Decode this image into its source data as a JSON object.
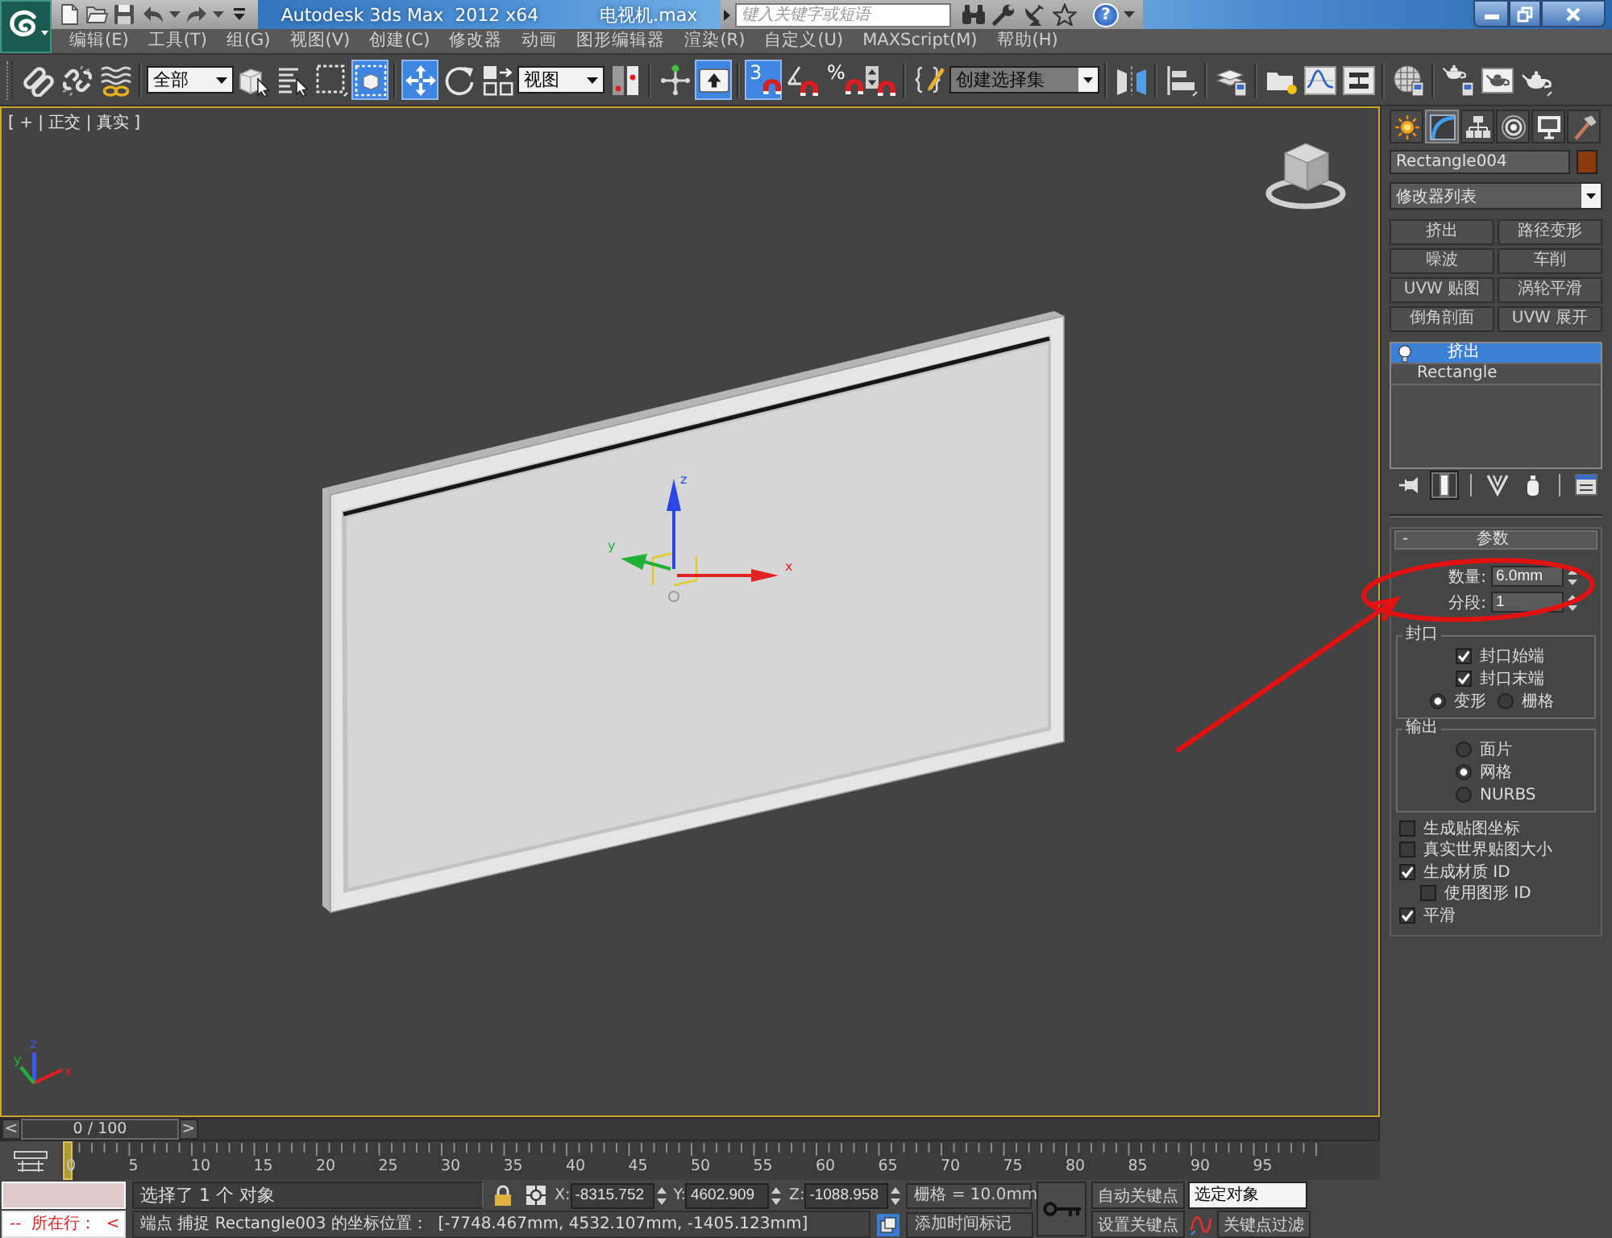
{
  "title_bar": {
    "title": "Autodesk 3ds Max  2012 x64",
    "document": "电视机.max",
    "search": {
      "placeholder": "键入关键字或短语"
    },
    "help": "?"
  },
  "menu_bar": {
    "items": [
      "编辑(E)",
      "工具(T)",
      "组(G)",
      "视图(V)",
      "创建(C)",
      "修改器",
      "动画",
      "图形编辑器",
      "渲染(R)",
      "自定义(U)",
      "MAXScript(M)",
      "帮助(H)"
    ]
  },
  "main_toolbar": {
    "items": [
      {
        "kind": "button",
        "selected": false
      },
      {
        "kind": "button",
        "selected": false
      },
      {
        "kind": "button",
        "selected": false
      },
      {
        "kind": "dropdown",
        "value": "全部"
      },
      {
        "kind": "button",
        "selected": false
      },
      {
        "kind": "button",
        "selected": false
      },
      {
        "kind": "button",
        "selected": false
      },
      {
        "kind": "button",
        "selected": true
      },
      {
        "kind": "button",
        "selected": true
      },
      {
        "kind": "button",
        "selected": false
      },
      {
        "kind": "button",
        "selected": false
      },
      {
        "kind": "dropdown",
        "value": "视图"
      },
      {
        "kind": "button",
        "selected": false
      },
      {
        "kind": "button",
        "selected": false
      },
      {
        "kind": "button",
        "selected": true
      },
      {
        "kind": "button",
        "label": "3",
        "selected": true
      },
      {
        "kind": "button",
        "selected": false
      },
      {
        "kind": "button",
        "label": "%",
        "selected": false
      },
      {
        "kind": "button",
        "selected": false
      },
      {
        "kind": "button",
        "selected": false
      },
      {
        "kind": "combo",
        "value": "创建选择集"
      },
      {
        "kind": "button",
        "selected": false
      },
      {
        "kind": "button",
        "selected": false
      },
      {
        "kind": "button",
        "selected": false
      },
      {
        "kind": "button",
        "selected": false
      },
      {
        "kind": "button",
        "selected": false
      },
      {
        "kind": "button",
        "selected": false
      },
      {
        "kind": "button",
        "selected": false
      },
      {
        "kind": "button",
        "selected": false
      },
      {
        "kind": "button",
        "selected": false
      },
      {
        "kind": "button",
        "selected": false
      }
    ]
  },
  "viewport": {
    "label": "[ + | 正交 | 真实 ]",
    "active": true,
    "gizmo_axes": [
      {
        "label": "z",
        "color": "#2a46e6"
      },
      {
        "label": "x",
        "color": "#e02424"
      },
      {
        "label": "y",
        "color": "#22b034"
      }
    ],
    "tripod_axes": [
      {
        "label": "z",
        "color": "#3a5ae8"
      },
      {
        "label": "x",
        "color": "#e02020"
      },
      {
        "label": "y",
        "color": "#22b034"
      }
    ]
  },
  "command_panel": {
    "tabs": [
      {
        "selected": false
      },
      {
        "selected": true
      },
      {
        "selected": false
      },
      {
        "selected": false
      },
      {
        "selected": false
      },
      {
        "selected": false
      }
    ],
    "object_name": "Rectangle004",
    "modifier_list": "修改器列表",
    "modifier_buttons": [
      "挤出",
      "路径变形",
      "噪波",
      "车削",
      "UVW 贴图",
      "涡轮平滑",
      "倒角剖面",
      "UVW 展开"
    ],
    "stack": [
      {
        "kind": "modifier",
        "label": "挤出",
        "selected": true
      },
      {
        "kind": "object",
        "label": "Rectangle",
        "selected": false
      }
    ],
    "stack_tools": [
      {
        "selected": false
      },
      {
        "selected": true
      },
      {
        "selected": false
      },
      {
        "selected": false
      },
      {
        "selected": false
      }
    ],
    "rollout": {
      "toggle": "-",
      "title": "参数",
      "spinners": [
        {
          "label": "数量:",
          "value": "6.0mm"
        },
        {
          "label": "分段:",
          "value": "1"
        }
      ],
      "groups": [
        {
          "title": "封口",
          "kind": "row",
          "checkboxes": [
            {
              "label": "封口始端",
              "checked": true
            },
            {
              "label": "封口末端",
              "checked": true
            }
          ],
          "radios": [
            {
              "label": "变形",
              "selected": true
            },
            {
              "label": "栅格",
              "selected": false
            }
          ]
        },
        {
          "title": "输出",
          "kind": "column",
          "radios": [
            {
              "label": "面片",
              "selected": false
            },
            {
              "label": "网格",
              "selected": true
            },
            {
              "label": "NURBS",
              "selected": false
            }
          ]
        }
      ],
      "options": [
        {
          "label": "生成贴图坐标",
          "checked": false
        },
        {
          "label": "真实世界贴图大小",
          "checked": false
        },
        {
          "label": "生成材质 ID",
          "checked": true,
          "children": [
            {
              "label": "使用图形 ID",
              "checked": false
            }
          ]
        },
        {
          "label": "平滑",
          "checked": true
        }
      ]
    }
  },
  "time_slider": {
    "prev": "<",
    "position": "0 / 100",
    "next": ">",
    "level": 0
  },
  "track_bar": {
    "labels": [
      "0",
      "5",
      "10",
      "15",
      "20",
      "25",
      "30",
      "35",
      "40",
      "45",
      "50",
      "55",
      "60",
      "65",
      "70",
      "75",
      "80",
      "85",
      "90",
      "95"
    ]
  },
  "script_listener": {
    "output": "--  所在行：  <"
  },
  "status_bar": {
    "selection": "选择了 1 个 对象",
    "coordinates": [
      {
        "label": "X:",
        "value": "-8315.752"
      },
      {
        "label": "Y:",
        "value": "4602.909"
      },
      {
        "label": "Z:",
        "value": "-1088.958"
      }
    ],
    "grid": "栅格 = 10.0mm",
    "prompt": "端点 捕捉 Rectangle003 的坐标位置：  [-7748.467mm, 4532.107mm, -1405.123mm]",
    "time_tag": "添加时间标记"
  },
  "animation_controls": {
    "auto_key": "自动关键点",
    "key_target": "选定对象",
    "set_key": "设置关键点",
    "key_filters": "关键点过滤"
  },
  "annotations": [
    {
      "kind": "ellipse"
    },
    {
      "kind": "arrow"
    }
  ]
}
